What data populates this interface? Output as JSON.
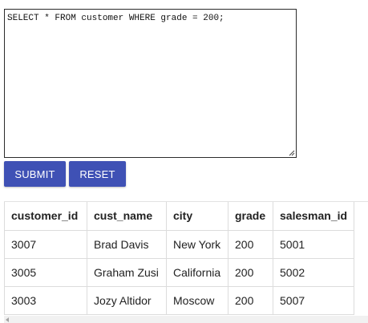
{
  "editor": {
    "query": "SELECT * FROM customer WHERE grade = 200;"
  },
  "buttons": {
    "submit_label": "SUBMIT",
    "reset_label": "RESET"
  },
  "colors": {
    "button_bg": "#3f51b5",
    "button_text": "#ffffff"
  },
  "results": {
    "columns": [
      "customer_id",
      "cust_name",
      "city",
      "grade",
      "salesman_id"
    ],
    "rows": [
      [
        "3007",
        "Brad Davis",
        "New York",
        "200",
        "5001"
      ],
      [
        "3005",
        "Graham Zusi",
        "California",
        "200",
        "5002"
      ],
      [
        "3003",
        "Jozy Altidor",
        "Moscow",
        "200",
        "5007"
      ]
    ]
  }
}
